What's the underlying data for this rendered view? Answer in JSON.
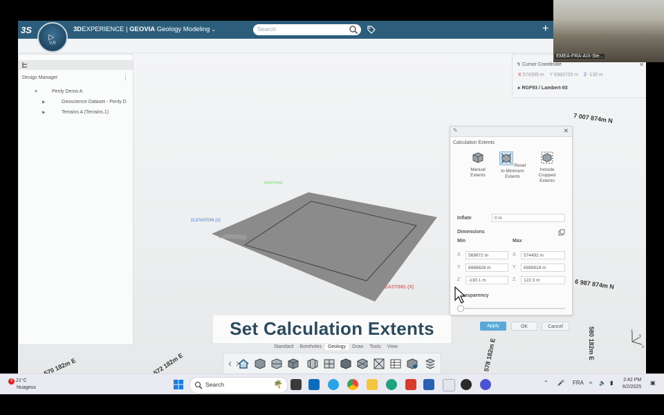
{
  "app": {
    "ds_logo": "3S",
    "brand_prefix": "3D",
    "brand_main": "EXPERIENCE | ",
    "brand_bold": "GEOVIA",
    "brand_app": " Geology Modeling",
    "compass_label": "V,R",
    "search_placeholder": "Search",
    "plus": "+"
  },
  "design_manager": {
    "title": "Design Manager",
    "tree": [
      {
        "label": "Penly Demo A",
        "toggle": "▼"
      },
      {
        "label": "Geoscience Dataset - Penly D",
        "toggle": "▶"
      },
      {
        "label": "Terrains A (Terrains.1)",
        "toggle": "▶"
      }
    ]
  },
  "cursor_panel": {
    "title": "Cursor Coordinate",
    "x_label": "X",
    "x_value": "574355 m",
    "y_label": "Y",
    "y_value": "6983725 m",
    "z_label": "Z",
    "z_value": "-130 m",
    "crs": "RGF93 / Lambert-93"
  },
  "coords": {
    "north_top": "7 007 874m N",
    "north_bottom": "6 987 874m N",
    "east_1": "570 182m E",
    "east_2": "572 182m E",
    "east_3": "578 182m E",
    "east_4": "580 182m E"
  },
  "scene_labels": {
    "elevation": "ELEVATION (Z)",
    "easting": "EASTING (X)",
    "northing": "NORTHING"
  },
  "dialog": {
    "title": "Calculation Extents",
    "tools": [
      {
        "label": "Manual Extents"
      },
      {
        "label": "Reset to Minimum Extents"
      },
      {
        "label": "Include Cropped Extents"
      }
    ],
    "inflate_label": "Inflate",
    "inflate_value": "0 m",
    "dimensions_label": "Dimensions",
    "min_label": "Min",
    "max_label": "Max",
    "min_x": "569872 m",
    "min_y": "6986828 m",
    "min_z": "-130.1 m",
    "max_x": "574492 m",
    "max_y": "6989919 m",
    "max_z": "122.3 m",
    "transparency_label": "Transparency",
    "transparency_value": 0,
    "apply": "Apply",
    "ok": "OK",
    "cancel": "Cancel"
  },
  "caption": "Set Calculation Extents",
  "action_tabs": [
    "Standard",
    "Boreholes",
    "Geology",
    "Draw",
    "Tools",
    "View"
  ],
  "active_tab": "Geology",
  "toolbar_icons": [
    "home-icon",
    "cube-icon",
    "surface-icon",
    "block-icon",
    "grid-icon",
    "section-icon",
    "solid-icon",
    "mesh-icon",
    "wireframe-icon",
    "table-icon",
    "query-icon",
    "stack-icon"
  ],
  "taskbar": {
    "temperature": "21°C",
    "weather": "Nuageux",
    "notification_count": "4",
    "search": "Search",
    "lang": "FRA",
    "time": "2:42 PM",
    "date": "6/2/2025"
  },
  "video": {
    "label": "EMEA-FRA-AIX-Ste..."
  },
  "colors": {
    "topbar": "#2c5e7b",
    "accent": "#5aa7d9",
    "caption_text": "#2b4a5e"
  }
}
